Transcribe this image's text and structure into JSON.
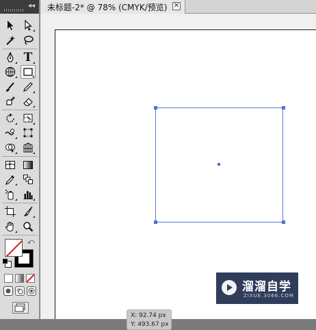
{
  "document": {
    "tab_title": "未标题-2* @ 78% (CMYK/预览)",
    "close_glyph": "✕"
  },
  "toolbox": {
    "collapse_glyph": "◂◂",
    "tools": [
      {
        "name": "selection-tool",
        "icon": "arrow-icon"
      },
      {
        "name": "direct-selection-tool",
        "icon": "hollow-arrow-icon"
      },
      {
        "name": "magic-wand-tool",
        "icon": "magic-wand-icon"
      },
      {
        "name": "lasso-tool",
        "icon": "lasso-icon"
      },
      {
        "name": "pen-tool",
        "icon": "pen-icon"
      },
      {
        "name": "type-tool",
        "icon": "type-icon",
        "glyph": "T"
      },
      {
        "name": "line-segment-tool",
        "icon": "grid-circle-icon"
      },
      {
        "name": "rectangle-tool",
        "icon": "rectangle-icon",
        "active": true
      },
      {
        "name": "paintbrush-tool",
        "icon": "brush-icon"
      },
      {
        "name": "pencil-tool",
        "icon": "pencil-icon"
      },
      {
        "name": "blob-brush-tool",
        "icon": "blob-brush-icon"
      },
      {
        "name": "eraser-tool",
        "icon": "eraser-icon"
      },
      {
        "name": "rotate-tool",
        "icon": "rotate-icon"
      },
      {
        "name": "scale-tool",
        "icon": "scale-icon"
      },
      {
        "name": "warp-tool",
        "icon": "warp-icon"
      },
      {
        "name": "free-transform-tool",
        "icon": "free-transform-icon"
      },
      {
        "name": "shape-builder-tool",
        "icon": "shape-builder-icon"
      },
      {
        "name": "perspective-grid-tool",
        "icon": "perspective-grid-icon"
      },
      {
        "name": "mesh-tool",
        "icon": "mesh-icon"
      },
      {
        "name": "gradient-tool",
        "icon": "gradient-icon"
      },
      {
        "name": "eyedropper-tool",
        "icon": "eyedropper-icon"
      },
      {
        "name": "blend-tool",
        "icon": "blend-icon"
      },
      {
        "name": "symbol-sprayer-tool",
        "icon": "symbol-sprayer-icon"
      },
      {
        "name": "column-graph-tool",
        "icon": "column-graph-icon"
      },
      {
        "name": "artboard-tool",
        "icon": "artboard-icon"
      },
      {
        "name": "slice-tool",
        "icon": "slice-icon"
      },
      {
        "name": "hand-tool",
        "icon": "hand-icon"
      },
      {
        "name": "zoom-tool",
        "icon": "zoom-icon"
      }
    ],
    "colors": {
      "fill": "none",
      "stroke": "#000000",
      "none_slash": "#e0141e"
    }
  },
  "canvas": {
    "selection_color": "#5a78d6",
    "coords": {
      "x": "X: 92.74 px",
      "y": "Y: 493.67 px"
    }
  },
  "watermark": {
    "title": "溜溜自学",
    "subtitle": "ZIXUE.3066.COM"
  }
}
